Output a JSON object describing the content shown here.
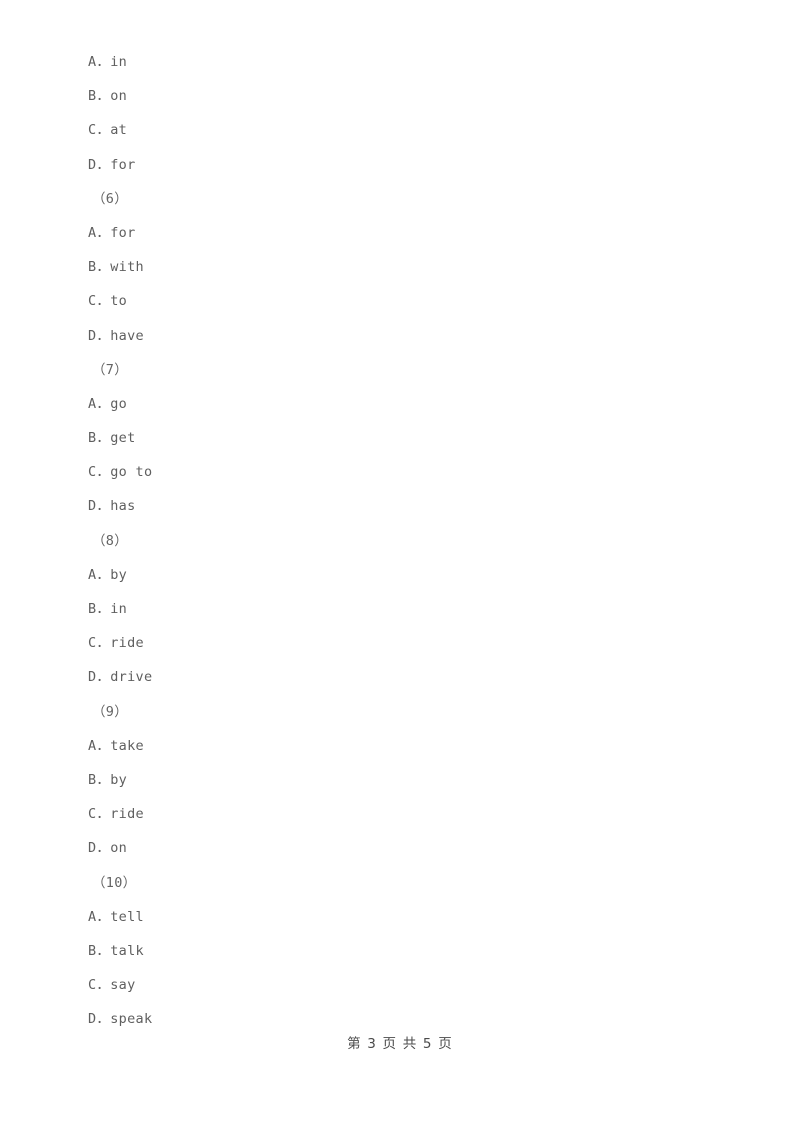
{
  "document": {
    "background_color": "#ffffff",
    "body_text_color": "#5f5f5f",
    "footer_text_color": "#4a4a4a"
  },
  "blocks": [
    {
      "item_label": "",
      "options": [
        {
          "text": "A．in"
        },
        {
          "text": "B．on"
        },
        {
          "text": "C．at"
        },
        {
          "text": "D．for"
        }
      ]
    },
    {
      "item_label": "（6）",
      "options": [
        {
          "text": "A．for"
        },
        {
          "text": "B．with"
        },
        {
          "text": "C．to"
        },
        {
          "text": "D．have"
        }
      ]
    },
    {
      "item_label": "（7）",
      "options": [
        {
          "text": "A．go"
        },
        {
          "text": "B．get"
        },
        {
          "text": "C．go to"
        },
        {
          "text": "D．has"
        }
      ]
    },
    {
      "item_label": "（8）",
      "options": [
        {
          "text": "A．by"
        },
        {
          "text": "B．in"
        },
        {
          "text": "C．ride"
        },
        {
          "text": "D．drive"
        }
      ]
    },
    {
      "item_label": "（9）",
      "options": [
        {
          "text": "A．take"
        },
        {
          "text": "B．by"
        },
        {
          "text": "C．ride"
        },
        {
          "text": "D．on"
        }
      ]
    },
    {
      "item_label": "（10）",
      "options": [
        {
          "text": "A．tell"
        },
        {
          "text": "B．talk"
        },
        {
          "text": "C．say"
        },
        {
          "text": "D．speak"
        }
      ]
    }
  ],
  "lines": [
    {
      "kind": "option",
      "text": "A．in"
    },
    {
      "kind": "option",
      "text": "B．on"
    },
    {
      "kind": "option",
      "text": "C．at"
    },
    {
      "kind": "option",
      "text": "D．for"
    },
    {
      "kind": "item",
      "text": "（6）"
    },
    {
      "kind": "option",
      "text": "A．for"
    },
    {
      "kind": "option",
      "text": "B．with"
    },
    {
      "kind": "option",
      "text": "C．to"
    },
    {
      "kind": "option",
      "text": "D．have"
    },
    {
      "kind": "item",
      "text": "（7）"
    },
    {
      "kind": "option",
      "text": "A．go"
    },
    {
      "kind": "option",
      "text": "B．get"
    },
    {
      "kind": "option",
      "text": "C．go to"
    },
    {
      "kind": "option",
      "text": "D．has"
    },
    {
      "kind": "item",
      "text": "（8）"
    },
    {
      "kind": "option",
      "text": "A．by"
    },
    {
      "kind": "option",
      "text": "B．in"
    },
    {
      "kind": "option",
      "text": "C．ride"
    },
    {
      "kind": "option",
      "text": "D．drive"
    },
    {
      "kind": "item",
      "text": "（9）"
    },
    {
      "kind": "option",
      "text": "A．take"
    },
    {
      "kind": "option",
      "text": "B．by"
    },
    {
      "kind": "option",
      "text": "C．ride"
    },
    {
      "kind": "option",
      "text": "D．on"
    },
    {
      "kind": "item",
      "text": "（10）"
    },
    {
      "kind": "option",
      "text": "A．tell"
    },
    {
      "kind": "option",
      "text": "B．talk"
    },
    {
      "kind": "option",
      "text": "C．say"
    },
    {
      "kind": "option",
      "text": "D．speak"
    }
  ],
  "footer": {
    "text": "第 3 页 共 5 页",
    "current_page": "3",
    "total_pages": "5"
  }
}
